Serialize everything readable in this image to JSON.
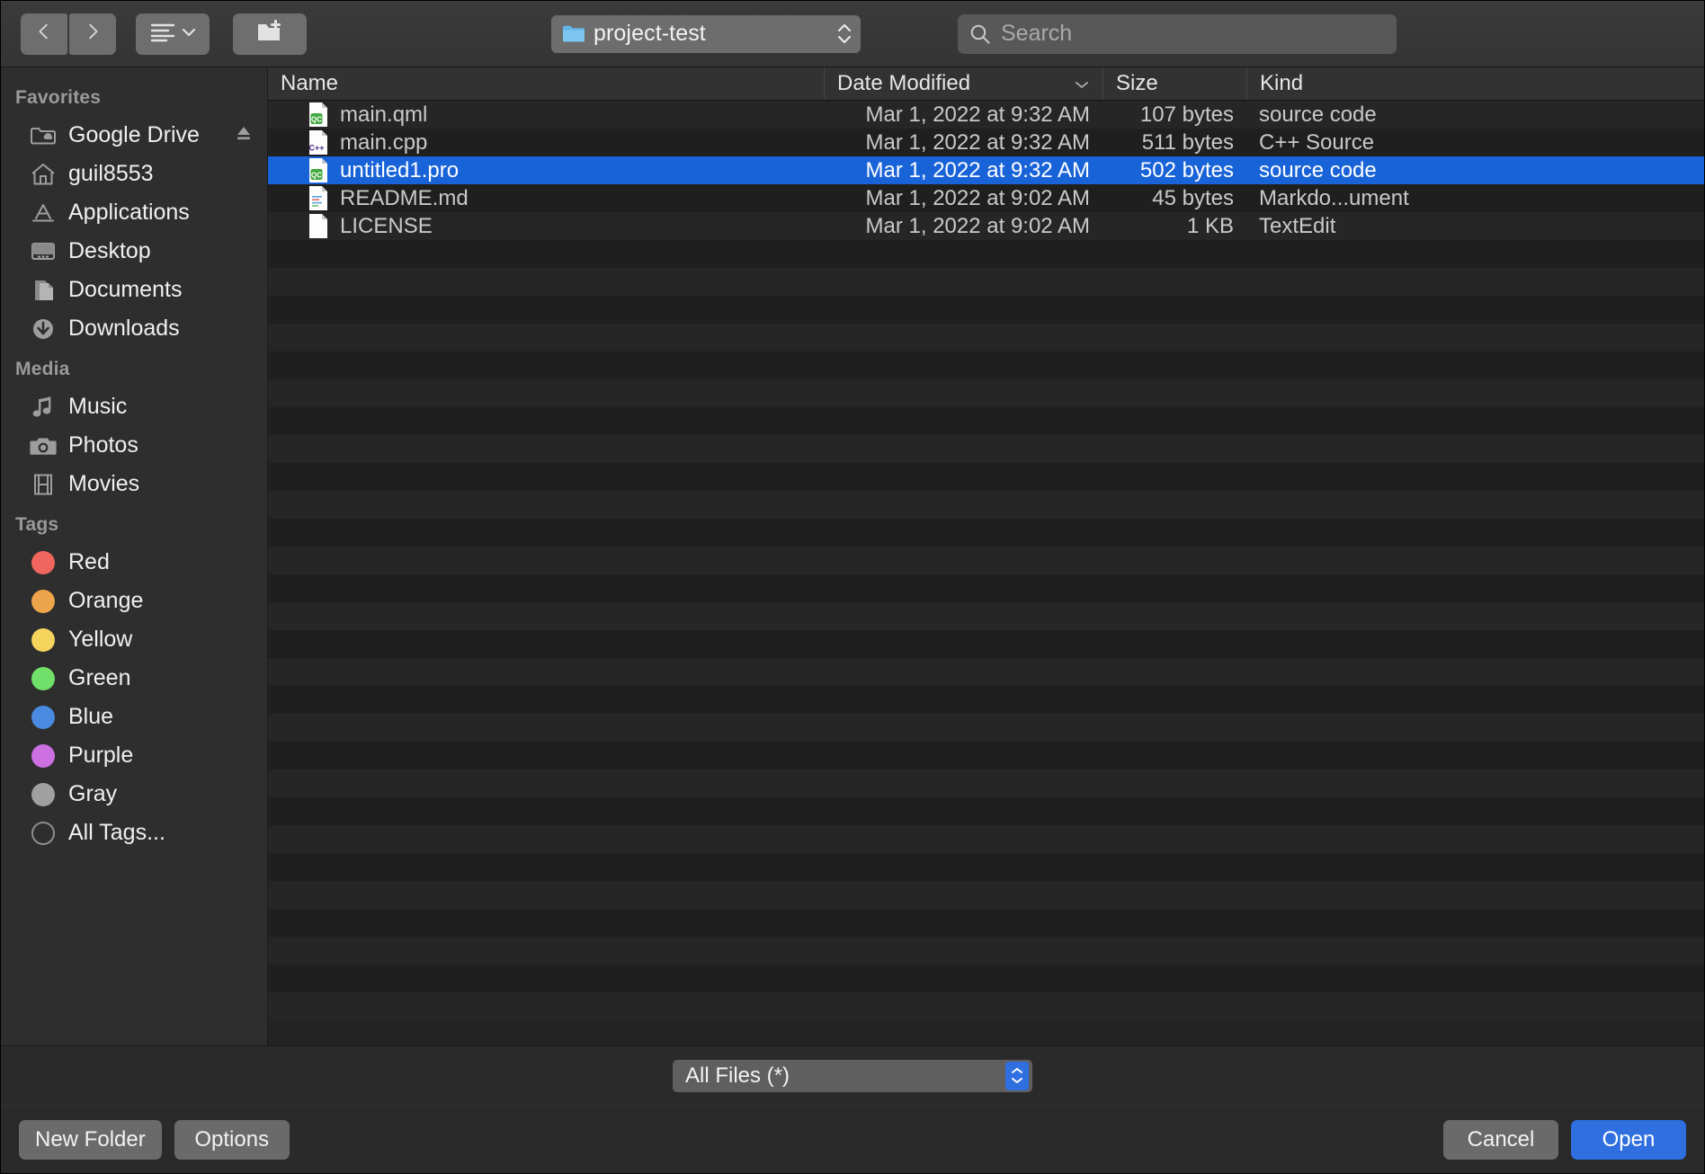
{
  "toolbar": {
    "back_icon": "chevron-left-icon",
    "forward_icon": "chevron-right-icon",
    "view_icon": "list-view-icon",
    "new_folder_icon": "new-folder-icon",
    "path": {
      "label": "project-test",
      "icon": "folder-icon"
    },
    "search": {
      "placeholder": "Search",
      "value": "",
      "icon": "search-icon"
    }
  },
  "sidebar": {
    "sections": [
      {
        "title": "Favorites",
        "items": [
          {
            "label": "Google Drive",
            "icon": "cloud-folder-icon",
            "eject": "eject-icon"
          },
          {
            "label": "guil8553",
            "icon": "home-icon"
          },
          {
            "label": "Applications",
            "icon": "applications-icon"
          },
          {
            "label": "Desktop",
            "icon": "desktop-icon"
          },
          {
            "label": "Documents",
            "icon": "documents-icon"
          },
          {
            "label": "Downloads",
            "icon": "downloads-icon"
          }
        ]
      },
      {
        "title": "Media",
        "items": [
          {
            "label": "Music",
            "icon": "music-note-icon"
          },
          {
            "label": "Photos",
            "icon": "camera-icon"
          },
          {
            "label": "Movies",
            "icon": "film-icon"
          }
        ]
      },
      {
        "title": "Tags",
        "items": [
          {
            "label": "Red",
            "icon": "tag-dot-icon",
            "color": "#f0655e"
          },
          {
            "label": "Orange",
            "icon": "tag-dot-icon",
            "color": "#eda44a"
          },
          {
            "label": "Yellow",
            "icon": "tag-dot-icon",
            "color": "#f5d45e"
          },
          {
            "label": "Green",
            "icon": "tag-dot-icon",
            "color": "#71e06a"
          },
          {
            "label": "Blue",
            "icon": "tag-dot-icon",
            "color": "#4a8ae0"
          },
          {
            "label": "Purple",
            "icon": "tag-dot-icon",
            "color": "#cc6fe0"
          },
          {
            "label": "Gray",
            "icon": "tag-dot-icon",
            "color": "#a0a0a0"
          },
          {
            "label": "All Tags...",
            "icon": "tag-ring-icon",
            "color": "ring"
          }
        ]
      }
    ]
  },
  "filelist": {
    "columns": [
      {
        "label": "Name",
        "key": "name"
      },
      {
        "label": "Date Modified",
        "key": "date",
        "sort_icon": "chevron-down-icon"
      },
      {
        "label": "Size",
        "key": "size"
      },
      {
        "label": "Kind",
        "key": "kind"
      }
    ],
    "rows": [
      {
        "name": "main.qml",
        "date": "Mar 1, 2022 at 9:32 AM",
        "size": "107 bytes",
        "kind": "source code",
        "icon": "qt-file-icon",
        "selected": false
      },
      {
        "name": "main.cpp",
        "date": "Mar 1, 2022 at 9:32 AM",
        "size": "511 bytes",
        "kind": "C++ Source",
        "icon": "cpp-file-icon",
        "selected": false
      },
      {
        "name": "untitled1.pro",
        "date": "Mar 1, 2022 at 9:32 AM",
        "size": "502 bytes",
        "kind": "source code",
        "icon": "qt-file-icon",
        "selected": true
      },
      {
        "name": "README.md",
        "date": "Mar 1, 2022 at 9:02 AM",
        "size": "45 bytes",
        "kind": "Markdo...ument",
        "icon": "markdown-file-icon",
        "selected": false
      },
      {
        "name": "LICENSE",
        "date": "Mar 1, 2022 at 9:02 AM",
        "size": "1 KB",
        "kind": "TextEdit",
        "icon": "plain-file-icon",
        "selected": false
      }
    ],
    "empty_row_count": 28
  },
  "filter": {
    "label": "All Files (*)",
    "stepper_icon": "stepper-icon"
  },
  "footer": {
    "new_folder_label": "New Folder",
    "options_label": "Options",
    "cancel_label": "Cancel",
    "open_label": "Open"
  },
  "colors": {
    "selection": "#1963d8",
    "accent": "#2f6fe0"
  }
}
